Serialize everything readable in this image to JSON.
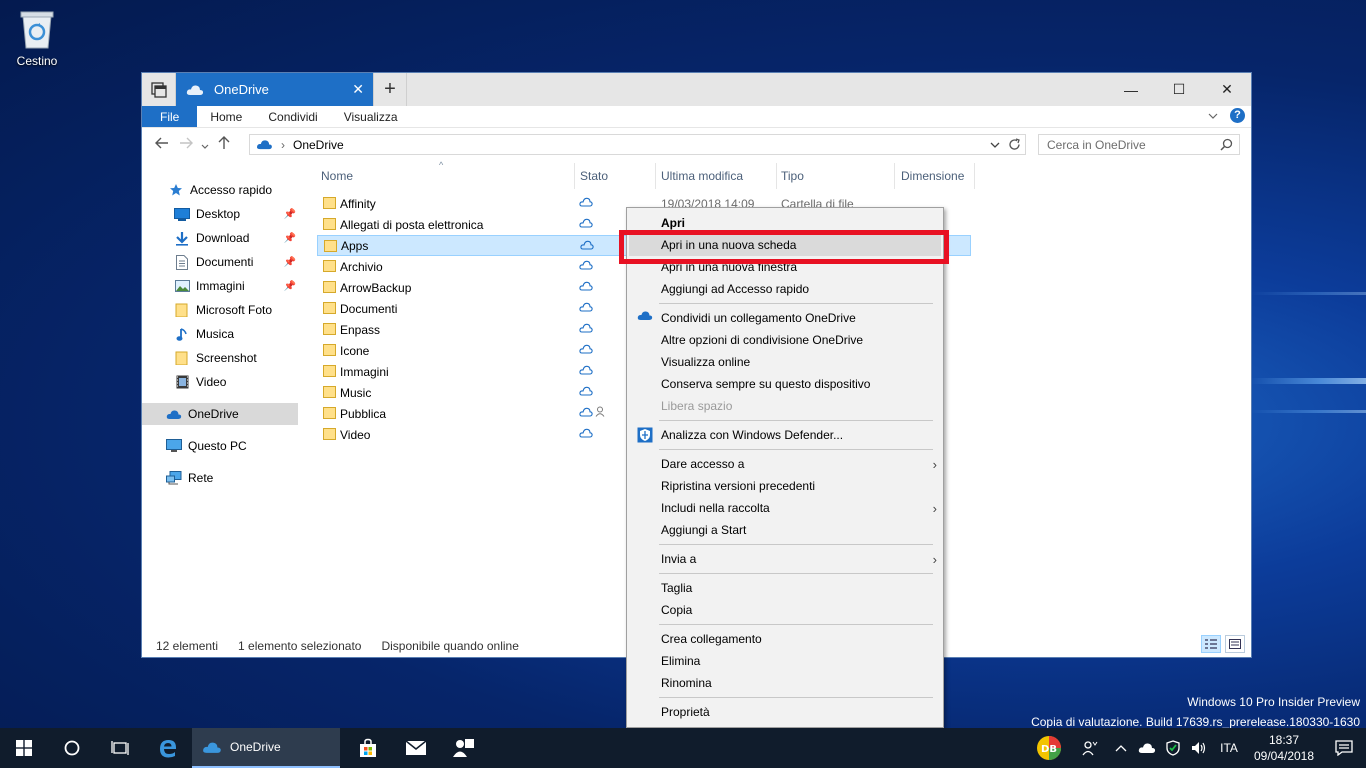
{
  "desktop": {
    "recycle_bin_label": "Cestino"
  },
  "window": {
    "tab_title": "OneDrive",
    "tab_close": "✕",
    "new_tab": "+",
    "minimize": "—",
    "maximize": "☐",
    "close": "✕"
  },
  "ribbon": {
    "tabs": [
      "File",
      "Home",
      "Condividi",
      "Visualizza"
    ],
    "help": "?"
  },
  "address": {
    "path": "OneDrive",
    "search_placeholder": "Cerca in OneDrive"
  },
  "nav_pane": {
    "items": [
      {
        "label": "Accesso rapido",
        "icon": "star-icon"
      },
      {
        "label": "Desktop",
        "icon": "desktop-icon",
        "pinned": true
      },
      {
        "label": "Download",
        "icon": "download-icon",
        "pinned": true
      },
      {
        "label": "Documenti",
        "icon": "document-icon",
        "pinned": true
      },
      {
        "label": "Immagini",
        "icon": "pictures-icon",
        "pinned": true
      },
      {
        "label": "Microsoft Foto",
        "icon": "folder-icon"
      },
      {
        "label": "Musica",
        "icon": "music-icon"
      },
      {
        "label": "Screenshot",
        "icon": "folder-icon"
      },
      {
        "label": "Video",
        "icon": "video-icon"
      },
      {
        "label": "OneDrive",
        "icon": "cloud-icon",
        "selected": true
      },
      {
        "label": "Questo PC",
        "icon": "pc-icon"
      },
      {
        "label": "Rete",
        "icon": "network-icon"
      }
    ]
  },
  "columns": [
    "Nome",
    "Stato",
    "Ultima modifica",
    "Tipo",
    "Dimensione"
  ],
  "files": [
    {
      "name": "Affinity",
      "date": "19/03/2018 14:09",
      "type": "Cartella di file"
    },
    {
      "name": "Allegati di posta elettronica"
    },
    {
      "name": "Apps",
      "selected": true
    },
    {
      "name": "Archivio"
    },
    {
      "name": "ArrowBackup"
    },
    {
      "name": "Documenti"
    },
    {
      "name": "Enpass"
    },
    {
      "name": "Icone"
    },
    {
      "name": "Immagini"
    },
    {
      "name": "Music"
    },
    {
      "name": "Pubblica",
      "shared": true
    },
    {
      "name": "Video"
    }
  ],
  "status": {
    "count": "12 elementi",
    "selected": "1 elemento selezionato",
    "availability": "Disponibile quando online"
  },
  "context_menu": {
    "groups": [
      [
        "Apri",
        "Apri in una nuova scheda",
        "Apri in una nuova finestra",
        "Aggiungi ad Accesso rapido"
      ],
      [
        "Condividi un collegamento OneDrive",
        "Altre opzioni di condivisione OneDrive",
        "Visualizza online",
        "Conserva sempre su questo dispositivo",
        "Libera spazio"
      ],
      [
        "Analizza con Windows Defender..."
      ],
      [
        "Dare accesso a",
        "Ripristina versioni precedenti",
        "Includi nella raccolta",
        "Aggiungi a Start"
      ],
      [
        "Invia a"
      ],
      [
        "Taglia",
        "Copia"
      ],
      [
        "Crea collegamento",
        "Elimina",
        "Rinomina"
      ],
      [
        "Proprietà"
      ]
    ],
    "highlighted": "Apri in una nuova scheda",
    "accent_color": "#e81123"
  },
  "watermark": {
    "line1": "Windows 10 Pro Insider Preview",
    "line2": "Copia di valutazione. Build 17639.rs_prerelease.180330-1630"
  },
  "taskbar": {
    "app_label": "OneDrive",
    "lang": "ITA",
    "time": "18:37",
    "date": "09/04/2018"
  }
}
